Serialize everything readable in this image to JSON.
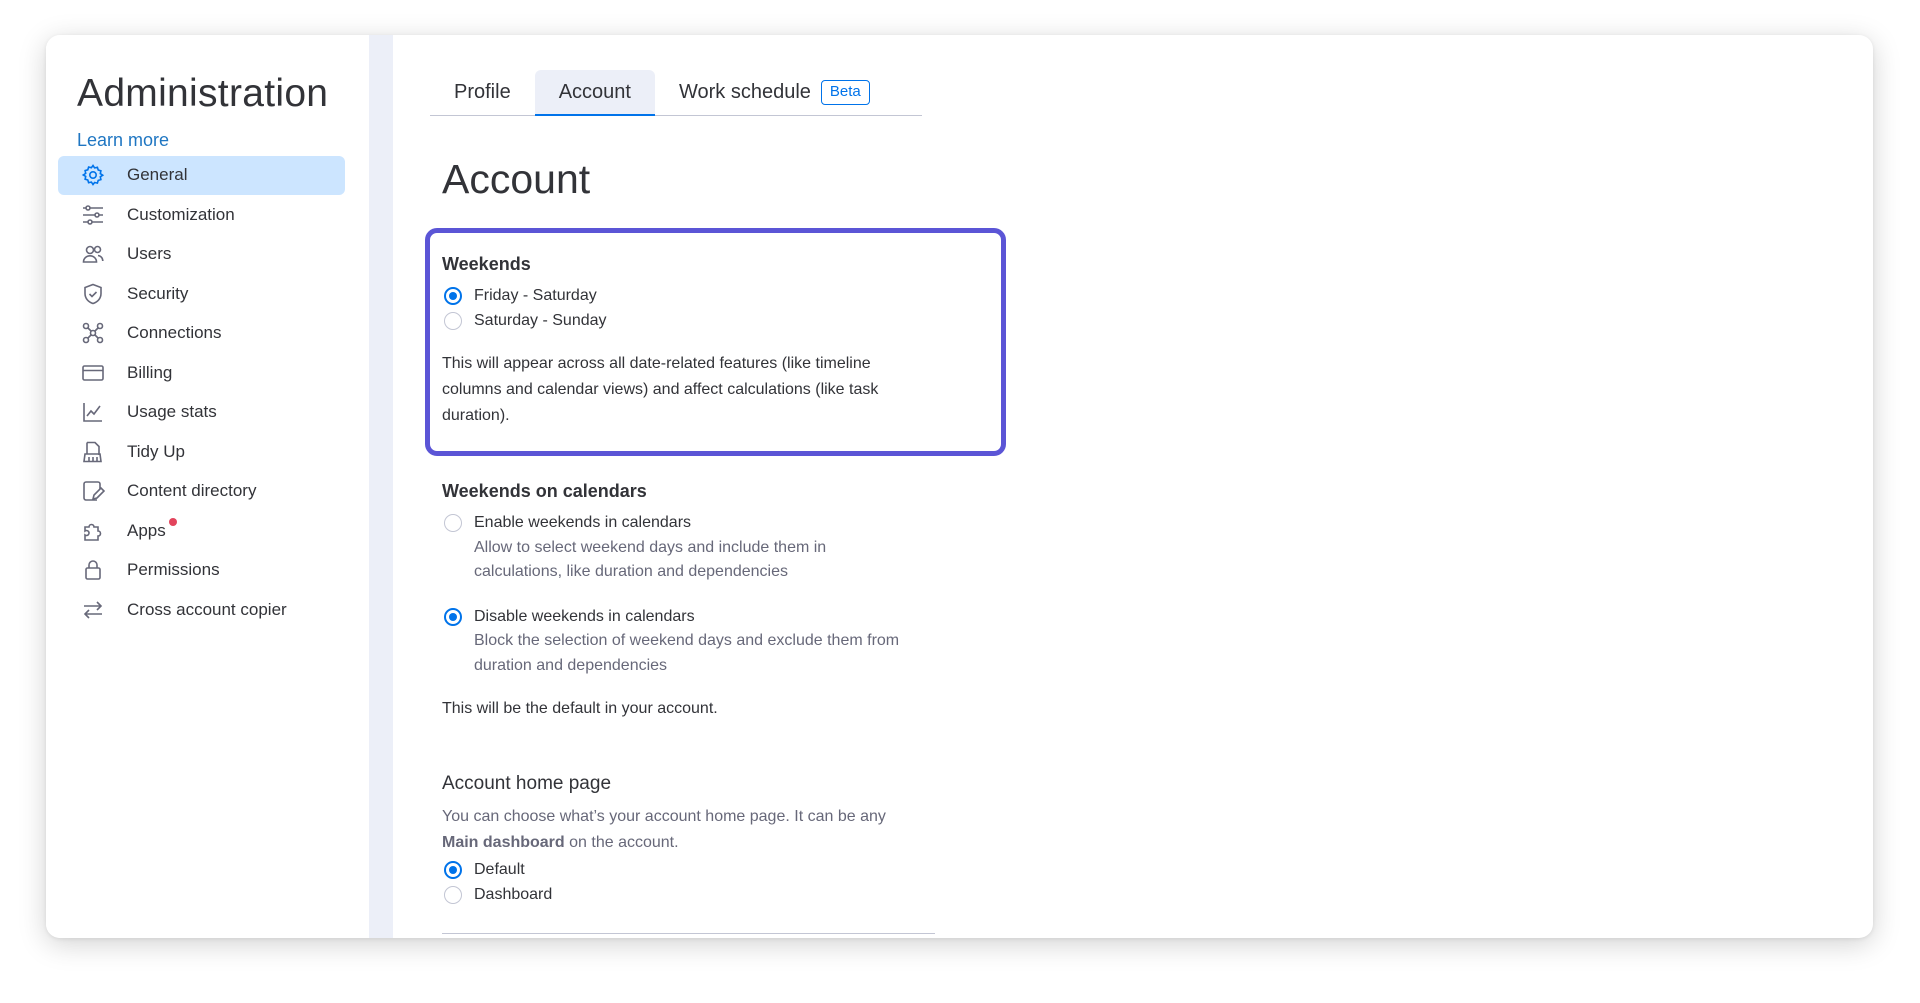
{
  "sidebar": {
    "title": "Administration",
    "learn_more": "Learn more",
    "items": [
      {
        "label": "General",
        "icon": "gear-icon",
        "active": true
      },
      {
        "label": "Customization",
        "icon": "sliders-icon"
      },
      {
        "label": "Users",
        "icon": "users-icon"
      },
      {
        "label": "Security",
        "icon": "shield-icon"
      },
      {
        "label": "Connections",
        "icon": "connections-icon"
      },
      {
        "label": "Billing",
        "icon": "credit-card-icon"
      },
      {
        "label": "Usage stats",
        "icon": "chart-line-icon"
      },
      {
        "label": "Tidy Up",
        "icon": "broom-icon"
      },
      {
        "label": "Content directory",
        "icon": "content-directory-icon"
      },
      {
        "label": "Apps",
        "icon": "puzzle-icon",
        "notification": true
      },
      {
        "label": "Permissions",
        "icon": "lock-icon"
      },
      {
        "label": "Cross account copier",
        "icon": "arrows-swap-icon"
      }
    ]
  },
  "tabs": [
    {
      "label": "Profile"
    },
    {
      "label": "Account",
      "active": true
    },
    {
      "label": "Work schedule",
      "badge": "Beta"
    }
  ],
  "page_title": "Account",
  "weekends": {
    "heading": "Weekends",
    "options": [
      {
        "label": "Friday - Saturday",
        "checked": true
      },
      {
        "label": "Saturday - Sunday",
        "checked": false
      }
    ],
    "description": "This will appear across all date-related features (like timeline columns and calendar views) and affect calculations (like task duration)."
  },
  "weekends_on_calendars": {
    "heading": "Weekends on calendars",
    "options": [
      {
        "label": "Enable weekends in calendars",
        "description": "Allow to select weekend days and include them in calculations, like duration and dependencies",
        "checked": false
      },
      {
        "label": "Disable weekends in calendars",
        "description": "Block the selection of weekend days and exclude them from duration and dependencies",
        "checked": true
      }
    ],
    "note": "This will be the default in your account."
  },
  "home_page": {
    "heading": "Account home page",
    "description_prefix": "You can choose what’s your account home page. It can be any",
    "description_bold": "Main dashboard",
    "description_suffix": "on the account.",
    "options": [
      {
        "label": "Default",
        "checked": true
      },
      {
        "label": "Dashboard",
        "checked": false
      }
    ]
  },
  "colors": {
    "accent": "#0073ea",
    "active_bg": "#cce5ff",
    "highlight_border": "#5b55d6",
    "notification": "#e2445c"
  }
}
